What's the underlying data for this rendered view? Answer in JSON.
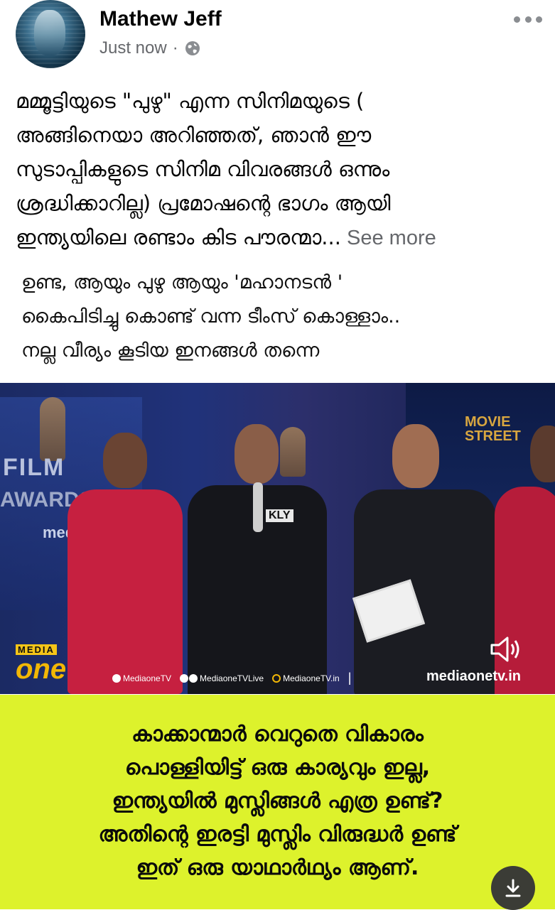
{
  "post": {
    "author": "Mathew Jeff",
    "time": "Just now",
    "separator": "·",
    "privacy_icon": "globe-icon",
    "more_icon": "more-horizontal-icon",
    "text_lines": [
      "മമ്മൂട്ടിയുടെ \"പുഴു\" എന്ന സിനിമയുടെ (",
      "അങ്ങിനെയാ അറിഞ്ഞത്, ഞാൻ ഈ",
      "സുടാപ്പികളുടെ സിനിമ വിവരങ്ങൾ ഒന്നും",
      "ശ്രദ്ധിക്കാറില്ല) പ്രമോഷന്റെ ഭാഗം ആയി",
      "ഇന്ത്യയിലെ രണ്ടാം കിട പൗരന്മാ..."
    ],
    "see_more": " See more"
  },
  "image": {
    "caption_lines": [
      "ഉണ്ട, ആയും പുഴു ആയും 'മഹാനടൻ '",
      "കൈപിടിച്ചു കൊണ്ട് വന്ന ടീംസ് കൊള്ളാം..",
      "നല്ല വീര്യം കൂടിയ ഇനങ്ങൾ തന്നെ"
    ],
    "video": {
      "watermark": "mediaonetv.in",
      "film_text": "FILM",
      "award_text": "AWARDS",
      "movie_street": "MOVIE",
      "street": "STREET",
      "shirt_text": "KLY",
      "logo_top": "MEDIA",
      "logo_bottom": "one",
      "socials": [
        "MediaoneTV",
        "MediaoneTVLive",
        "MediaoneTV.in"
      ],
      "divider": "|",
      "site": "mediaonetv.in",
      "speaker_icon": "speaker-icon"
    },
    "bottom_lines": [
      "കാക്കാന്മാർ വെറുതെ വികാരം",
      "പൊള്ളിയിട്ട് ഒരു കാര്യവും ഇല്ല,",
      "ഇന്ത്യയിൽ മുസ്ലിങ്ങൾ എത്ര ഉണ്ട്?",
      "അതിന്റെ ഇരട്ടി മുസ്ലിം വിരുദ്ധർ ഉണ്ട്",
      "ഇത് ഒരു യാഥാർഥ്യം ആണ്."
    ],
    "download_icon": "download-icon",
    "bottom_bg": "#ddf22c"
  }
}
